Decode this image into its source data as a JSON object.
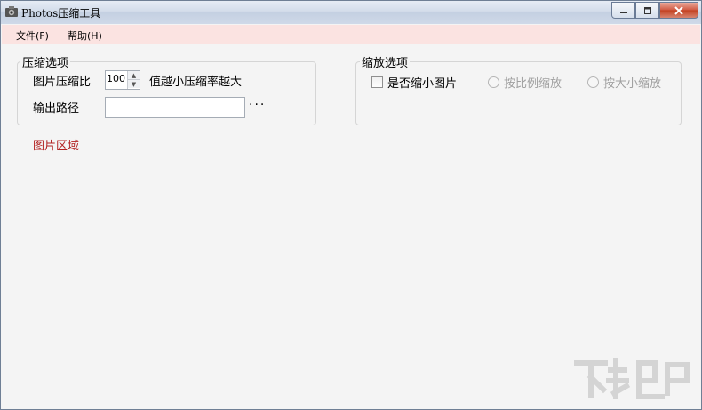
{
  "window": {
    "title": "Photos压缩工具"
  },
  "menu": {
    "items": [
      {
        "label": "文件(F)"
      },
      {
        "label": "帮助(H)"
      }
    ]
  },
  "compress": {
    "group_title": "压缩选项",
    "ratio_label": "图片压缩比",
    "ratio_value": "100",
    "hint": "值越小压缩率越大",
    "output_label": "输出路径",
    "output_value": "",
    "browse_label": "···"
  },
  "scale": {
    "group_title": "缩放选项",
    "shrink_label": "是否缩小图片",
    "shrink_checked": false,
    "by_ratio_label": "按比例缩放",
    "by_size_label": "按大小缩放"
  },
  "image_area": {
    "label": "图片区域"
  },
  "colors": {
    "menubar_bg": "#fbe3e1",
    "image_area_text": "#b22222",
    "close_button": "#c8462a"
  }
}
